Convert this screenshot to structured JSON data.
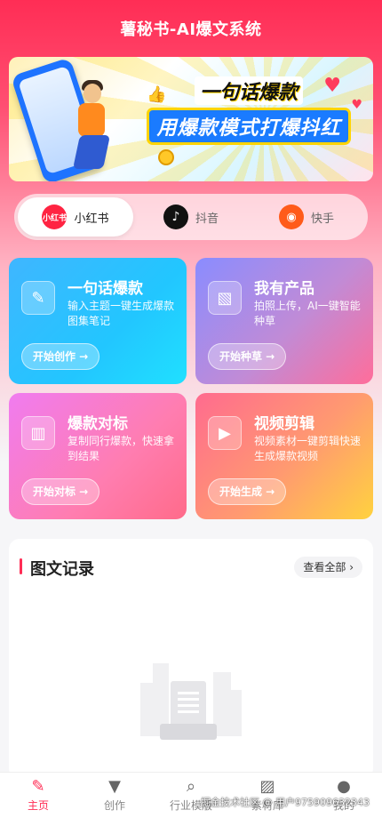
{
  "header": {
    "title": "薯秘书-AI爆文系统"
  },
  "banner": {
    "line1": "一句话爆款",
    "line2": "用爆款模式打爆抖红"
  },
  "platforms": [
    {
      "label": "小红书",
      "icon_text": "小红书",
      "icon": "xiaohongshu-icon",
      "active": true
    },
    {
      "label": "抖音",
      "icon_text": "♪",
      "icon": "douyin-icon",
      "active": false
    },
    {
      "label": "快手",
      "icon_text": "◉",
      "icon": "kuaishou-icon",
      "active": false
    }
  ],
  "features": [
    {
      "title": "一句话爆款",
      "desc": "输入主题一键生成爆款图集笔记",
      "button": "开始创作 →",
      "icon": "edit-icon",
      "glyph": "✎"
    },
    {
      "title": "我有产品",
      "desc": "拍照上传，AI一键智能种草",
      "button": "开始种草 →",
      "icon": "image-icon",
      "glyph": "▧"
    },
    {
      "title": "爆款对标",
      "desc": "复制同行爆款，快速拿到结果",
      "button": "开始对标 →",
      "icon": "bar-chart-icon",
      "glyph": "▥"
    },
    {
      "title": "视频剪辑",
      "desc": "视频素材一键剪辑快速生成爆款视频",
      "button": "开始生成 →",
      "icon": "play-icon",
      "glyph": "▶"
    }
  ],
  "records": {
    "title": "图文记录",
    "view_all": "查看全部 ›"
  },
  "tabbar": [
    {
      "label": "主页",
      "icon": "home-icon",
      "glyph": "✎",
      "active": true
    },
    {
      "label": "创作",
      "icon": "bookmark-icon",
      "glyph": "▼",
      "active": false
    },
    {
      "label": "行业模版",
      "icon": "search-icon",
      "glyph": "⌕",
      "active": false
    },
    {
      "label": "素材库",
      "icon": "gallery-icon",
      "glyph": "▨",
      "active": false
    },
    {
      "label": "我的",
      "icon": "user-icon",
      "glyph": "●",
      "active": false
    }
  ],
  "watermark": "掘金技术社区 @ 用户975909632343",
  "colors": {
    "accent": "#ff2d55"
  }
}
